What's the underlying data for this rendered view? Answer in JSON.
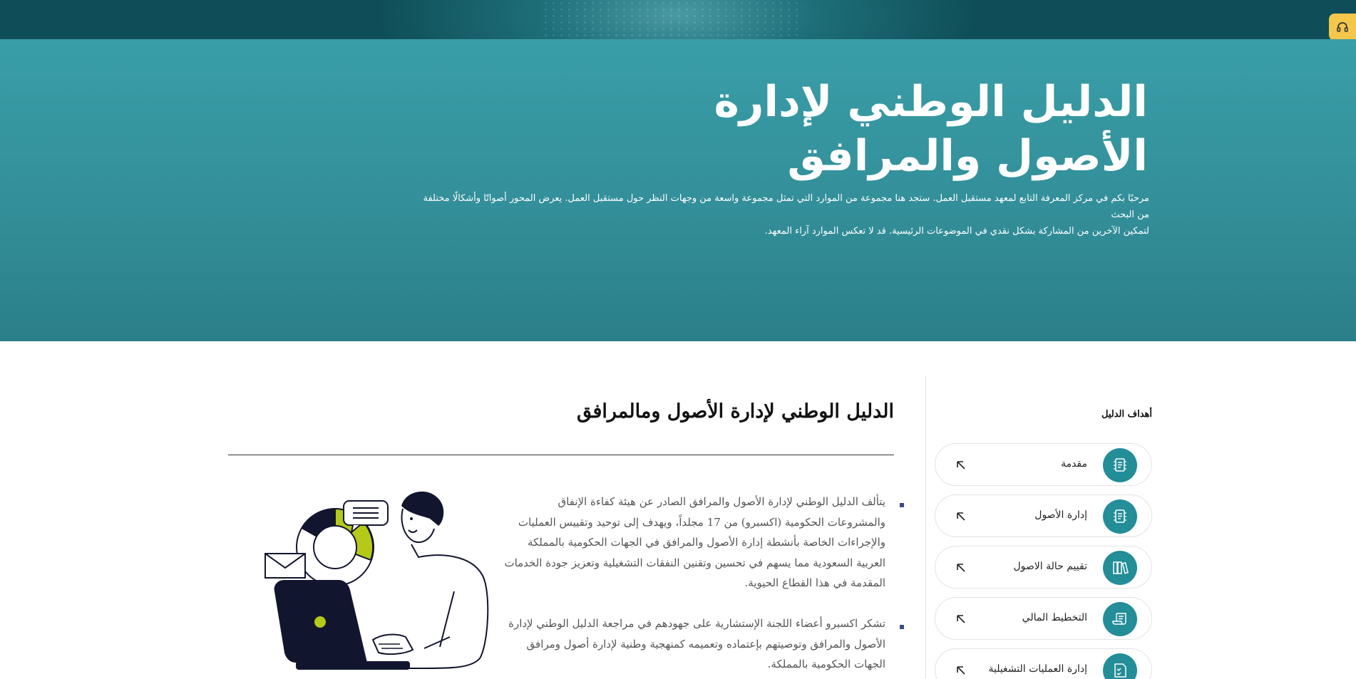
{
  "hero": {
    "title_line1": "الدليل الوطني لإدارة",
    "title_line2": "الأصول والمرافق",
    "description_line1": "مرحبًا بكم في مركز المعرفة التابع لمعهد مستقبل العمل. ستجد هنا مجموعة من الموارد التي تمثل مجموعة واسعة من وجهات النظر حول مستقبل العمل. يعرض المحور أصواتًا وأشكالًا مختلفة من البحث",
    "description_line2": "لتمكين الآخرين من المشاركة بشكل نقدي في الموضوعات الرئيسية. قد لا تعكس الموارد آراء المعهد."
  },
  "sidebar": {
    "heading": "أهداف الدليل",
    "items": [
      {
        "label": "مقدمة",
        "icon": "document-icon"
      },
      {
        "label": "إدارة الأصول",
        "icon": "document-icon"
      },
      {
        "label": "تقييم حالة الاصول",
        "icon": "books-icon"
      },
      {
        "label": "التخطيط المالي",
        "icon": "scroll-icon"
      },
      {
        "label": "إدارة العمليات التشغيلية",
        "icon": "checklist-icon"
      }
    ]
  },
  "main": {
    "title": "الدليل الوطني لإدارة الأصول ومالمرافق",
    "paragraphs": [
      "يتألف الدليل الوطني لإدارة الأصول والمرافق الصادر عن هيئة كفاءة الإنفاق والمشروعات الحكومية (اكسبرو) من 17 مجلداً، ويهدف إلى توحيد وتقييس العمليات والإجراءات الخاصة بأنشطة إدارة الأصول والمرافق في الجهات الحكومية بالمملكة العربية السعودية مما يسهم في تحسين وتقنين النفقات التشغيلية وتعزيز جودة الخدمات المقدمة في هذا القطاع الحيوية.",
      "تشكر اكسبرو أعضاء اللجنة الإستشارية على جهودهم في مراجعة الدليل الوطني لإدارة الأصول والمرافق وتوصيتهم بإعتماده وتعميمه كمنهجية وطنية لإدارة أصول ومرافق الجهات الحكومية بالمملكة."
    ]
  },
  "colors": {
    "hero": "#338f99",
    "accent": "#238d98",
    "support": "#f4c64a",
    "illustration_accent": "#b5c918",
    "ink": "#12152e"
  }
}
